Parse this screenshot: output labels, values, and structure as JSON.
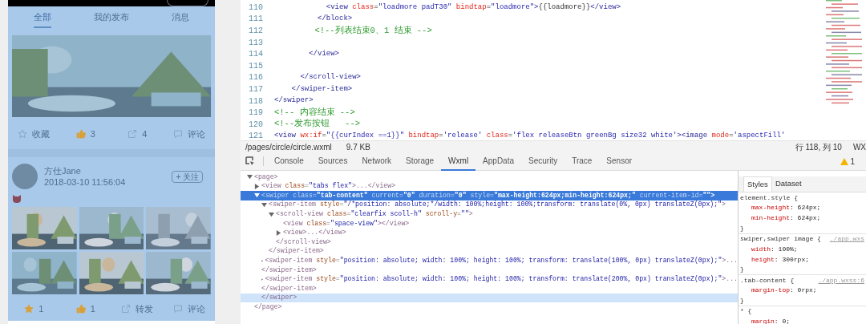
{
  "phone": {
    "tabs": [
      {
        "label": "全部",
        "selected": true
      },
      {
        "label": "我的发布",
        "selected": false
      },
      {
        "label": "消息",
        "selected": false
      }
    ],
    "first_post": {
      "actions": [
        {
          "kind": "star",
          "label": "收藏",
          "active": false
        },
        {
          "kind": "like",
          "label": "3",
          "active": true
        },
        {
          "kind": "share",
          "label": "4",
          "active": false
        },
        {
          "kind": "comment",
          "label": "评论",
          "active": false
        }
      ]
    },
    "second_post": {
      "author": "方仕Jane",
      "time": "2018-03-10 11:56:04",
      "follow": "+ 关注",
      "actions": [
        {
          "kind": "star",
          "label": "1",
          "active": true
        },
        {
          "kind": "like",
          "label": "1",
          "active": true
        },
        {
          "kind": "share",
          "label": "转发",
          "active": false
        },
        {
          "kind": "comment",
          "label": "评论",
          "active": false
        }
      ]
    }
  },
  "editor": {
    "lines": [
      {
        "number": "110",
        "tokens": [
          {
            "kind": "tag",
            "text": "            <view "
          },
          {
            "kind": "attr",
            "text": "class"
          },
          {
            "kind": "punct",
            "text": "="
          },
          {
            "kind": "string",
            "text": "\"loadmore padT30\" "
          },
          {
            "kind": "attr",
            "text": "bindtap"
          },
          {
            "kind": "punct",
            "text": "="
          },
          {
            "kind": "string",
            "text": "\"loadmore\""
          },
          {
            "kind": "tag",
            "text": ">"
          },
          {
            "kind": "punct",
            "text": "{{loadmore}}"
          },
          {
            "kind": "tag",
            "text": "</view>"
          }
        ]
      },
      {
        "number": "111",
        "tokens": [
          {
            "kind": "tag",
            "text": "          </block>"
          }
        ]
      },
      {
        "number": "112",
        "tokens": [
          {
            "kind": "comment",
            "text": "        <!--列表结束0、1 结束 -->"
          }
        ]
      },
      {
        "number": "113"
      },
      {
        "number": "114",
        "tokens": [
          {
            "kind": "tag",
            "text": "        </view>"
          }
        ]
      },
      {
        "number": "115"
      },
      {
        "number": "116",
        "tokens": [
          {
            "kind": "tag",
            "text": "      </scroll-view>"
          }
        ]
      },
      {
        "number": "117",
        "tokens": [
          {
            "kind": "tag",
            "text": "    </swiper-item>"
          }
        ]
      },
      {
        "number": "118",
        "tokens": [
          {
            "kind": "tag",
            "text": "</swiper>"
          }
        ]
      },
      {
        "number": "119",
        "tokens": [
          {
            "kind": "comment",
            "text": "<!-- 内容结束 -->"
          }
        ]
      },
      {
        "number": "120",
        "tokens": [
          {
            "kind": "comment",
            "text": "<!--发布按钮   -->"
          }
        ]
      },
      {
        "number": "121",
        "tokens": [
          {
            "kind": "tag",
            "text": "<view "
          },
          {
            "kind": "attr",
            "text": "wx:if"
          },
          {
            "kind": "punct",
            "text": "="
          },
          {
            "kind": "string",
            "text": "\"{{curIndex ==1}}\" "
          },
          {
            "kind": "attr",
            "text": "bindtap"
          },
          {
            "kind": "punct",
            "text": "="
          },
          {
            "kind": "string",
            "text": "'release' "
          },
          {
            "kind": "attr",
            "text": "class"
          },
          {
            "kind": "punct",
            "text": "="
          },
          {
            "kind": "string",
            "text": "'flex releaseBtn greenBg size32 white'"
          },
          {
            "kind": "tag",
            "text": "><image "
          },
          {
            "kind": "attr",
            "text": "mode"
          },
          {
            "kind": "punct",
            "text": "="
          },
          {
            "kind": "string",
            "text": "'aspectFill'"
          }
        ]
      }
    ],
    "status_bar": {
      "path": "/pages/circle/circle.wxml",
      "size": "9.7 KB",
      "position": "行 118, 列 10",
      "encoding": "WX"
    }
  },
  "devtools": {
    "tabs": [
      {
        "label": "Console",
        "selected": false
      },
      {
        "label": "Sources",
        "selected": false
      },
      {
        "label": "Network",
        "selected": false
      },
      {
        "label": "Storage",
        "selected": false
      },
      {
        "label": "Wxml",
        "selected": true
      },
      {
        "label": "AppData",
        "selected": false
      },
      {
        "label": "Security",
        "selected": false
      },
      {
        "label": "Trace",
        "selected": false
      },
      {
        "label": "Sensor",
        "selected": false
      }
    ],
    "warning_count": "1",
    "tree": [
      {
        "kind": "expandable",
        "expanded": true,
        "selected": false,
        "tokens": [
          {
            "kind": "tag",
            "text": "<page>"
          }
        ],
        "close": "</page>",
        "close_hovered": false,
        "children": [
          {
            "kind": "expandable",
            "expanded": false,
            "selected": false,
            "tokens": [
              {
                "kind": "tag",
                "text": "<view "
              },
              {
                "kind": "attr",
                "text": "class"
              },
              {
                "kind": "punct",
                "text": "="
              },
              {
                "kind": "string",
                "text": "\"tabs flex\""
              },
              {
                "kind": "tag",
                "text": ">...</view>"
              }
            ]
          },
          {
            "kind": "expandable",
            "expanded": true,
            "selected": true,
            "tokens": [
              {
                "kind": "tag",
                "text": "<swiper "
              },
              {
                "kind": "attr",
                "text": "class"
              },
              {
                "kind": "punct",
                "text": "="
              },
              {
                "kind": "string",
                "text": "\"tab-content\" "
              },
              {
                "kind": "attr",
                "text": "current"
              },
              {
                "kind": "punct",
                "text": "="
              },
              {
                "kind": "string",
                "text": "\"0\" "
              },
              {
                "kind": "attr",
                "text": "duration"
              },
              {
                "kind": "punct",
                "text": "="
              },
              {
                "kind": "string",
                "text": "\"0\" "
              },
              {
                "kind": "attr",
                "text": "style"
              },
              {
                "kind": "punct",
                "text": "="
              },
              {
                "kind": "string",
                "text": "\"max-height:624px;min-height:624px;\" "
              },
              {
                "kind": "attr",
                "text": "current-item-id"
              },
              {
                "kind": "punct",
                "text": "="
              },
              {
                "kind": "string",
                "text": "\"\">"
              }
            ],
            "close": "</swiper>",
            "close_hovered": true,
            "children": [
              {
                "kind": "expandable",
                "expanded": true,
                "selected": false,
                "tokens": [
                  {
                    "kind": "tag",
                    "text": "<swiper-item "
                  },
                  {
                    "kind": "attr",
                    "text": "style"
                  },
                  {
                    "kind": "punct",
                    "text": "="
                  },
                  {
                    "kind": "string",
                    "text": "\"/*position: absolute;*/width: 100%;height: 100%;transform: translate(0%, 0px) translateZ(0px);\""
                  },
                  {
                    "kind": "tag",
                    "text": ">"
                  }
                ],
                "close": "</swiper-item>",
                "close_hovered": false,
                "children": [
                  {
                    "kind": "expandable",
                    "expanded": true,
                    "selected": false,
                    "tokens": [
                      {
                        "kind": "tag",
                        "text": "<scroll-view "
                      },
                      {
                        "kind": "attr",
                        "text": "class"
                      },
                      {
                        "kind": "punct",
                        "text": "="
                      },
                      {
                        "kind": "string",
                        "text": "\"clearfix scoll-h\" "
                      },
                      {
                        "kind": "attr",
                        "text": "scroll-y"
                      },
                      {
                        "kind": "punct",
                        "text": "="
                      },
                      {
                        "kind": "string",
                        "text": "\"\""
                      },
                      {
                        "kind": "tag",
                        "text": ">"
                      }
                    ],
                    "close": "</scroll-view>",
                    "close_hovered": false,
                    "children": [
                      {
                        "kind": "leaf",
                        "selected": false,
                        "tokens": [
                          {
                            "kind": "tag",
                            "text": "<view "
                          },
                          {
                            "kind": "attr",
                            "text": "class"
                          },
                          {
                            "kind": "punct",
                            "text": "="
                          },
                          {
                            "kind": "string",
                            "text": "\"space-view\""
                          },
                          {
                            "kind": "tag",
                            "text": "></view>"
                          }
                        ]
                      },
                      {
                        "kind": "expandable",
                        "expanded": false,
                        "selected": false,
                        "tokens": [
                          {
                            "kind": "tag",
                            "text": "<view>...</view>"
                          }
                        ]
                      }
                    ]
                  }
                ]
              },
              {
                "kind": "expandable",
                "expanded": false,
                "selected": false,
                "tokens": [
                  {
                    "kind": "tag",
                    "text": "<swiper-item "
                  },
                  {
                    "kind": "attr",
                    "text": "style"
                  },
                  {
                    "kind": "punct",
                    "text": "="
                  },
                  {
                    "kind": "string",
                    "text": "\"position: absolute; width: 100%; height: 100%; transform: translate(100%, 0px) translateZ(0px);\""
                  },
                  {
                    "kind": "tag",
                    "text": ">..."
                  }
                ],
                "close": "</swiper-item>",
                "close_hovered": false
              },
              {
                "kind": "expandable",
                "expanded": false,
                "selected": false,
                "tokens": [
                  {
                    "kind": "tag",
                    "text": "<swiper-item "
                  },
                  {
                    "kind": "attr",
                    "text": "style"
                  },
                  {
                    "kind": "punct",
                    "text": "="
                  },
                  {
                    "kind": "string",
                    "text": "\"position: absolute; width: 100%; height: 100%; transform: translate(200%, 0px) translateZ(0px);\""
                  },
                  {
                    "kind": "tag",
                    "text": ">..."
                  }
                ],
                "close": "</swiper-item>",
                "close_hovered": false
              }
            ]
          }
        ]
      }
    ],
    "styles": {
      "tabs": [
        {
          "label": "Styles",
          "selected": true
        },
        {
          "label": "Dataset",
          "selected": false
        }
      ],
      "rules": [
        {
          "selector": "element.style {",
          "declarations": [
            {
              "property": "max-height",
              "value": ": 624px;"
            },
            {
              "property": "min-height",
              "value": ": 624px;"
            }
          ],
          "close": "}"
        },
        {
          "selector": "swiper,swiper image {",
          "source": "./app.wxs",
          "declarations": [
            {
              "property": "width",
              "value": ": 100%;"
            },
            {
              "property": "height",
              "value": ": 300rpx;"
            }
          ],
          "close": "}"
        },
        {
          "selector": ".tab-content {",
          "source": "./app.wxss:6",
          "declarations": [
            {
              "property": "margin-top",
              "value": ": 0rpx;"
            }
          ],
          "close": "}"
        },
        {
          "selector": "* {",
          "declarations": [
            {
              "property": "margin",
              "value": ": 0;"
            }
          ]
        }
      ]
    }
  }
}
